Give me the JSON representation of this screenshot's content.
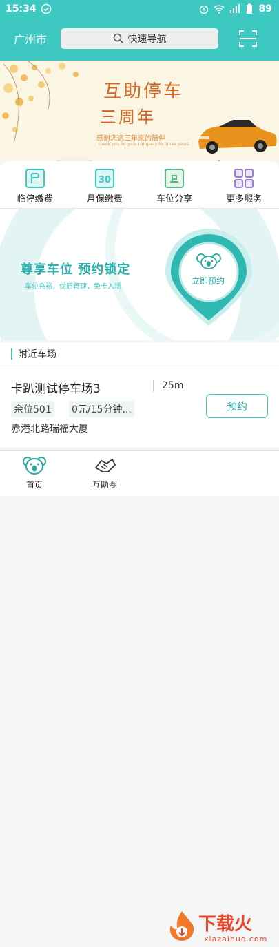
{
  "status_bar": {
    "time": "15:34",
    "battery": "89"
  },
  "header": {
    "city": "广州市",
    "search_placeholder": "快速导航"
  },
  "banner": {
    "title_line1": "互助停车",
    "title_line2": "三周年",
    "subtitle": "感谢您这三年来的陪伴",
    "subtitle_en": "thank you for your company for three years"
  },
  "services": [
    {
      "label": "临停缴费",
      "icon": "temporary-parking-icon"
    },
    {
      "label": "月保缴费",
      "icon": "monthly-pass-icon"
    },
    {
      "label": "车位分享",
      "icon": "space-share-icon"
    },
    {
      "label": "更多服务",
      "icon": "more-services-icon"
    }
  ],
  "promo": {
    "title": "尊享车位  预约锁定",
    "subtitle": "车位充裕，优质管理，免卡入场",
    "cta": "立即预约"
  },
  "nearby": {
    "title": "附近车场",
    "lots": [
      {
        "name": "卡趴测试停车场3",
        "distance": "25m",
        "spaces": "余位501",
        "price": "0元/15分钟...",
        "address": "赤港北路瑞福大厦",
        "book_label": "预约"
      }
    ]
  },
  "tabbar": [
    {
      "label": "首页",
      "icon": "koala-home-icon"
    },
    {
      "label": "互助圈",
      "icon": "handshake-icon"
    }
  ],
  "watermark": {
    "text": "下载火",
    "url": "xiazaihuo.com"
  },
  "colors": {
    "primary": "#3ec8c2",
    "accent": "#29a8a2",
    "banner_text": "#d4661f"
  }
}
